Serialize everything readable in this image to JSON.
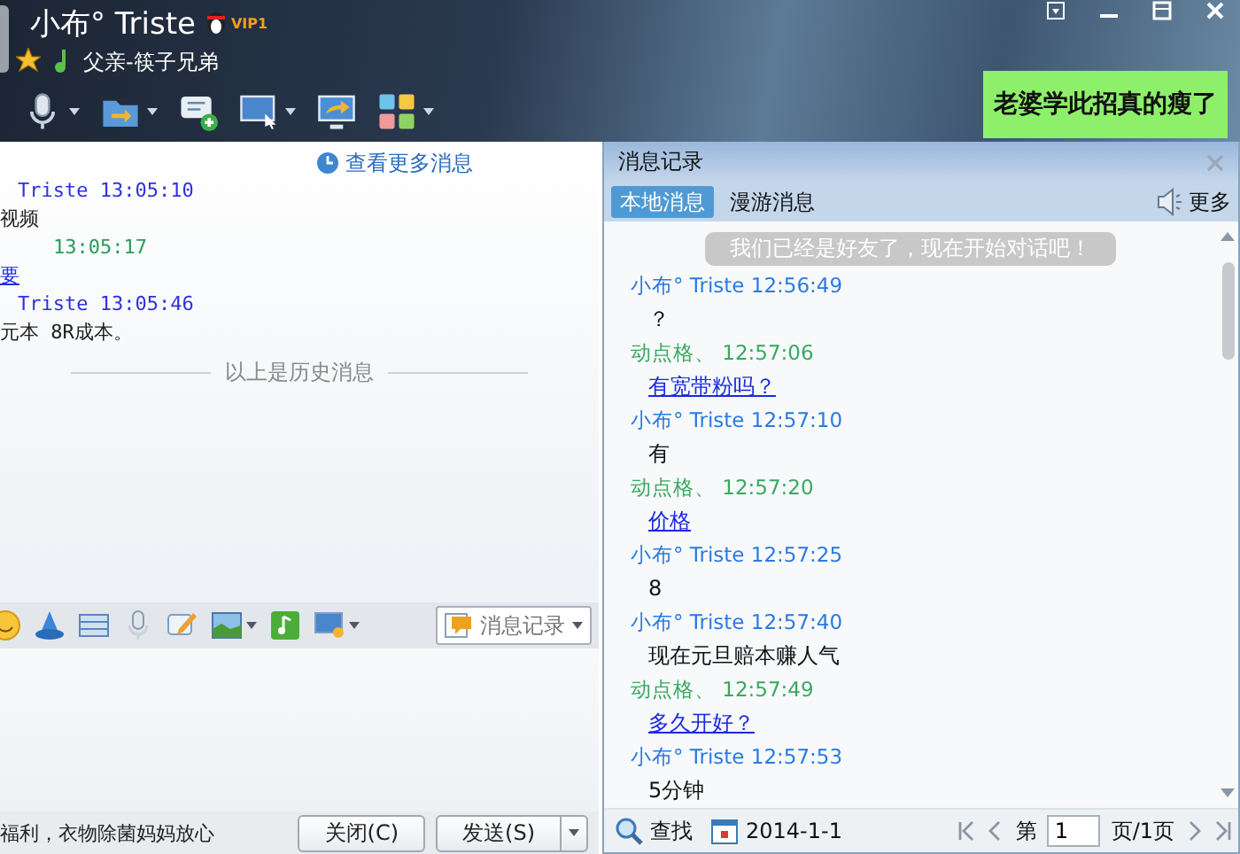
{
  "header": {
    "name": "小布° Triste",
    "vip": "VIP1",
    "signature": "父亲-筷子兄弟",
    "tools": [
      {
        "kind": "mic",
        "has_menu": true
      },
      {
        "kind": "folder",
        "has_menu": true
      },
      {
        "kind": "chat_add",
        "has_menu": false
      },
      {
        "kind": "monitor_cursor",
        "has_menu": true
      },
      {
        "kind": "monitor_share",
        "has_menu": false
      },
      {
        "kind": "apps",
        "has_menu": true
      }
    ],
    "ad": "老婆学此招真的瘦了"
  },
  "history": {
    "more_link": "查看更多消息",
    "lines": [
      {
        "kind": "self_header",
        "text": "Triste  13:05:10"
      },
      {
        "kind": "text",
        "text": "视频"
      },
      {
        "kind": "friend_header",
        "text": "13:05:17"
      },
      {
        "kind": "link",
        "text": "要"
      },
      {
        "kind": "self_header",
        "text": "Triste  13:05:46"
      },
      {
        "kind": "text",
        "text": "元本 8R成本。"
      }
    ],
    "divider": "以上是历史消息"
  },
  "input_toolbar": {
    "tools": [
      {
        "kind": "smiley",
        "has_menu": false
      },
      {
        "kind": "hat",
        "has_menu": false
      },
      {
        "kind": "film",
        "has_menu": false
      },
      {
        "kind": "mic",
        "has_menu": false
      },
      {
        "kind": "note",
        "has_menu": false
      },
      {
        "kind": "image",
        "has_menu": true
      },
      {
        "kind": "music",
        "has_menu": false
      },
      {
        "kind": "monitor",
        "has_menu": true
      }
    ],
    "history_button": "消息记录"
  },
  "bottom_bar": {
    "ticker": "福利，衣物除菌妈妈放心",
    "close_button": "关闭(C)",
    "send_button": "发送(S)"
  },
  "record_panel": {
    "title": "消息记录",
    "tabs": [
      {
        "label": "本地消息",
        "selected": true
      },
      {
        "label": "漫游消息",
        "selected": false
      }
    ],
    "more": "更多",
    "notice": "我们已经是好友了，现在开始对话吧！",
    "messages": [
      {
        "kind": "self",
        "header": "小布° Triste 12:56:49",
        "text": "？",
        "link": false
      },
      {
        "kind": "friend",
        "header": "动点格、 12:57:06",
        "text": "有宽带粉吗？",
        "link": true
      },
      {
        "kind": "self",
        "header": "小布° Triste 12:57:10",
        "text": "有",
        "link": false
      },
      {
        "kind": "friend",
        "header": "动点格、 12:57:20",
        "text": "价格",
        "link": true
      },
      {
        "kind": "self",
        "header": "小布° Triste 12:57:25",
        "text": "8",
        "link": false
      },
      {
        "kind": "self",
        "header": "小布° Triste 12:57:40",
        "text": "现在元旦赔本赚人气",
        "link": false
      },
      {
        "kind": "friend",
        "header": "动点格、 12:57:49",
        "text": "多久开好？",
        "link": true
      },
      {
        "kind": "self",
        "header": "小布° Triste 12:57:53",
        "text": "5分钟",
        "link": false
      }
    ],
    "footer": {
      "search": "查找",
      "date": "2014-1-1",
      "page_prefix": "第",
      "page": "1",
      "page_suffix": "页/1页"
    }
  }
}
